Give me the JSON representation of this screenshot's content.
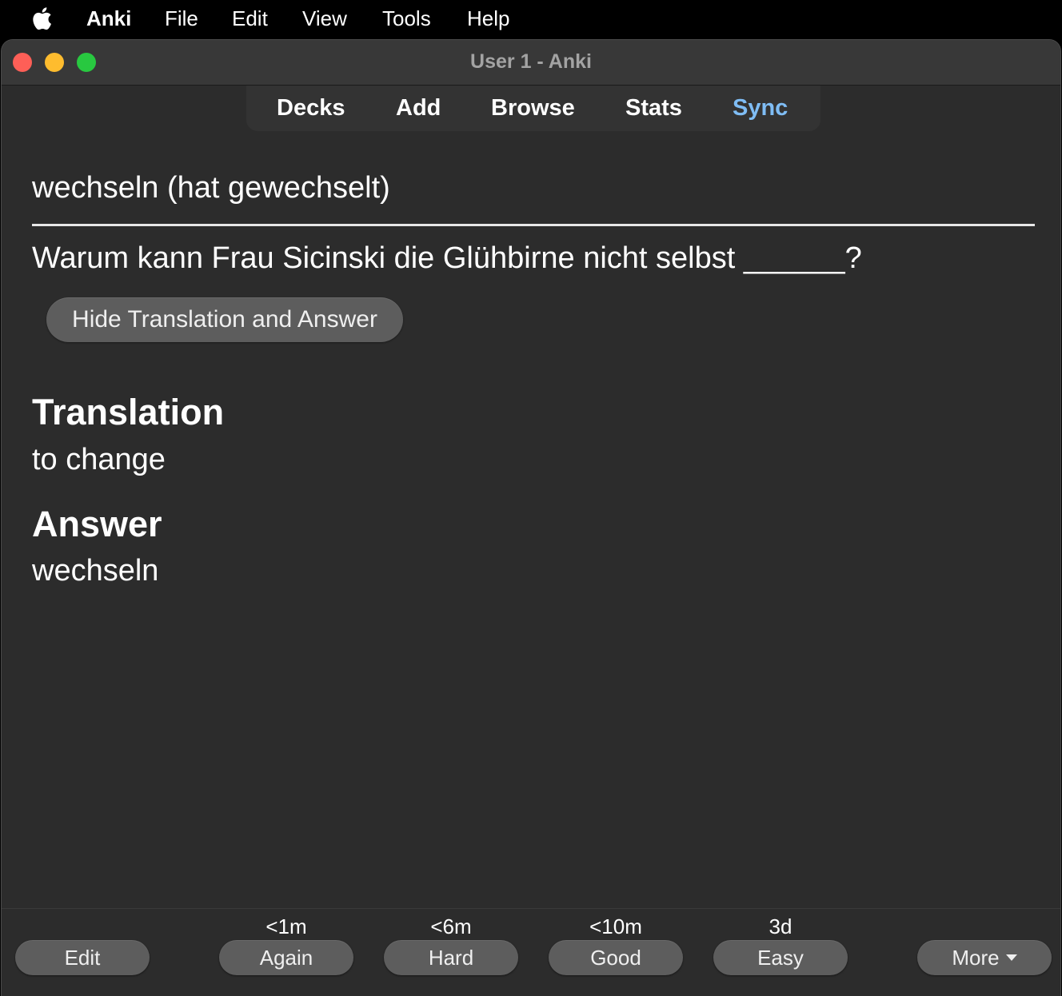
{
  "menubar": {
    "apple_icon": "apple-icon",
    "app_name": "Anki",
    "items": [
      "File",
      "Edit",
      "View",
      "Tools",
      "Help"
    ]
  },
  "window": {
    "title": "User 1 - Anki",
    "traffic_lights": {
      "close": "#fe5f57",
      "minimize": "#febc2e",
      "maximize": "#28c840"
    }
  },
  "toolbar": {
    "items": [
      "Decks",
      "Add",
      "Browse",
      "Stats",
      "Sync"
    ],
    "sync_color": "#7fbdf5"
  },
  "card": {
    "front": "wechseln (hat gewechselt)",
    "question": "Warum kann Frau Sicinski die Glühbirne nicht selbst ______?",
    "toggle_button": "Hide Translation and Answer",
    "translation_heading": "Translation",
    "translation_text": "to change",
    "answer_heading": "Answer",
    "answer_text": "wechseln"
  },
  "bottom": {
    "edit_label": "Edit",
    "answers": [
      {
        "interval": "<1m",
        "label": "Again"
      },
      {
        "interval": "<6m",
        "label": "Hard"
      },
      {
        "interval": "<10m",
        "label": "Good"
      },
      {
        "interval": "3d",
        "label": "Easy"
      }
    ],
    "more_label": "More"
  }
}
